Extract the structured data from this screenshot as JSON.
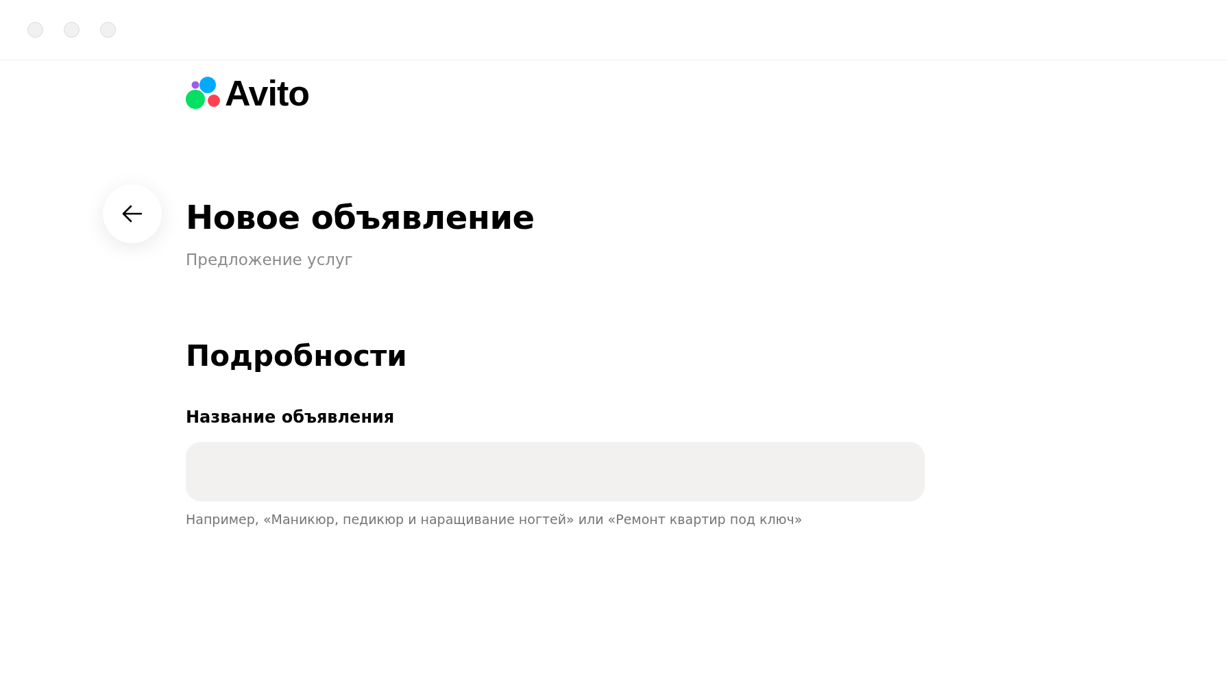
{
  "logo": {
    "text": "Avito"
  },
  "header": {
    "title": "Новое объявление",
    "subtitle": "Предложение услуг"
  },
  "section": {
    "title": "Подробности"
  },
  "field": {
    "label": "Название объявления",
    "hint": "Например, «Маникюр, педикюр и наращивание ногтей» или «Ремонт квартир под ключ»"
  }
}
